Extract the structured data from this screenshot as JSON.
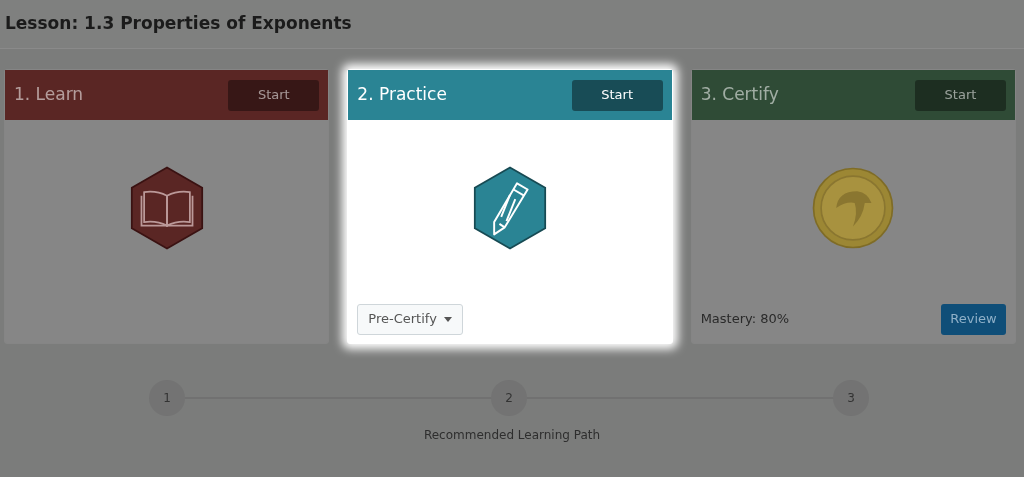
{
  "lesson_title": "Lesson: 1.3 Properties of Exponents",
  "cards": [
    {
      "title": "1. Learn",
      "color": "#5a2624",
      "highlighted": false,
      "start_button": "Start",
      "kind": "learn",
      "footer": {
        "kind": "none"
      }
    },
    {
      "title": "2. Practice",
      "color": "#2a8494",
      "highlighted": true,
      "start_button": "Start",
      "kind": "practice",
      "footer": {
        "kind": "dropdown",
        "label": "Pre-Certify"
      }
    },
    {
      "title": "3. Certify",
      "color": "#2f4b36",
      "highlighted": false,
      "start_button": "Start",
      "kind": "certify",
      "footer": {
        "kind": "mastery",
        "text": "Mastery: 80%",
        "button": "Review"
      }
    }
  ],
  "path": {
    "steps": [
      "1",
      "2",
      "3"
    ],
    "caption": "Recommended Learning Path"
  }
}
